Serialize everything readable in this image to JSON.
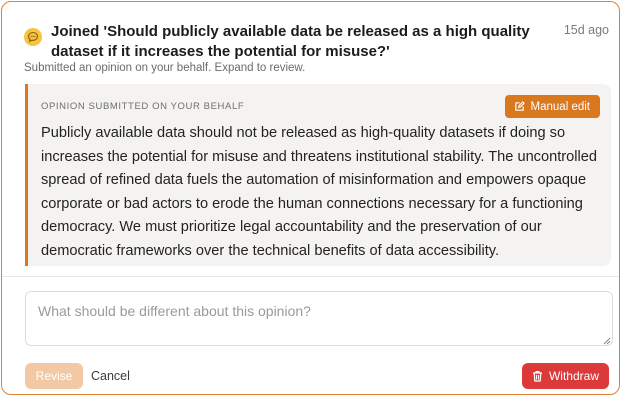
{
  "header": {
    "title": "Joined 'Should publicly available data be released as a high quality dataset if it increases the potential for misuse?'",
    "time_ago": "15d ago",
    "subtitle": "Submitted an opinion on your behalf. Expand to review.",
    "icon": "chat-bubble-icon"
  },
  "opinion": {
    "label": "OPINION SUBMITTED ON YOUR BEHALF",
    "manual_edit_label": "Manual edit",
    "text": "Publicly available data should not be released as high-quality datasets if doing so increases the potential for misuse and threatens institutional stability. The uncontrolled spread of refined data fuels the automation of misinformation and empowers opaque corporate or bad actors to erode the human connections necessary for a functioning democracy. We must prioritize legal accountability and the preservation of our democratic frameworks over the technical benefits of data accessibility."
  },
  "feedback": {
    "placeholder": "What should be different about this opinion?",
    "value": ""
  },
  "actions": {
    "revise_label": "Revise",
    "cancel_label": "Cancel",
    "withdraw_label": "Withdraw"
  },
  "colors": {
    "accent": "#d9781f",
    "danger": "#dc3a3a",
    "icon_yellow": "#f6c443"
  }
}
